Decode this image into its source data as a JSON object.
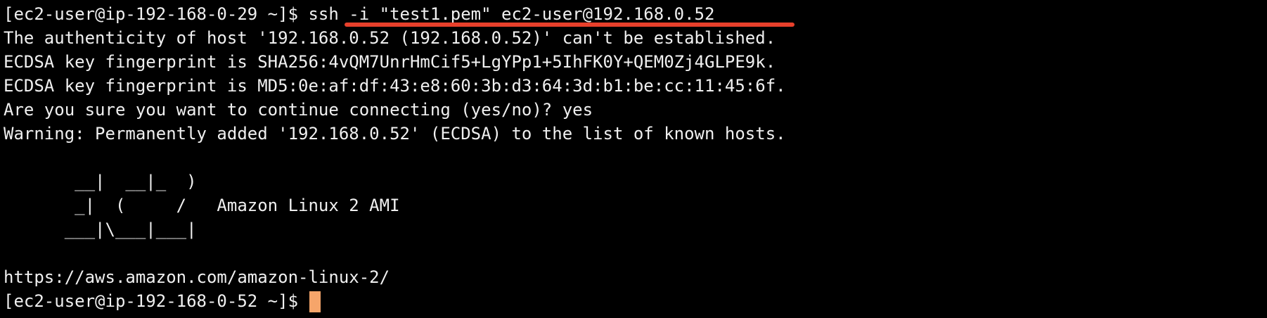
{
  "terminal": {
    "lines": [
      "[ec2-user@ip-192-168-0-29 ~]$ ssh -i \"test1.pem\" ec2-user@192.168.0.52",
      "The authenticity of host '192.168.0.52 (192.168.0.52)' can't be established.",
      "ECDSA key fingerprint is SHA256:4vQM7UnrHmCif5+LgYPp1+5IhFK0Y+QEM0Zj4GLPE9k.",
      "ECDSA key fingerprint is MD5:0e:af:df:43:e8:60:3b:d3:64:3d:b1:be:cc:11:45:6f.",
      "Are you sure you want to continue connecting (yes/no)? yes",
      "Warning: Permanently added '192.168.0.52' (ECDSA) to the list of known hosts.",
      "",
      "       __|  __|_  )",
      "       _|  (     /   Amazon Linux 2 AMI",
      "      ___|\\___|___|",
      "",
      "https://aws.amazon.com/amazon-linux-2/"
    ],
    "prompt": "[ec2-user@ip-192-168-0-52 ~]$ "
  },
  "colors": {
    "background": "#000000",
    "text": "#f0f0f0",
    "cursor": "#f6a56a",
    "annotation_underline": "#e8402b"
  }
}
